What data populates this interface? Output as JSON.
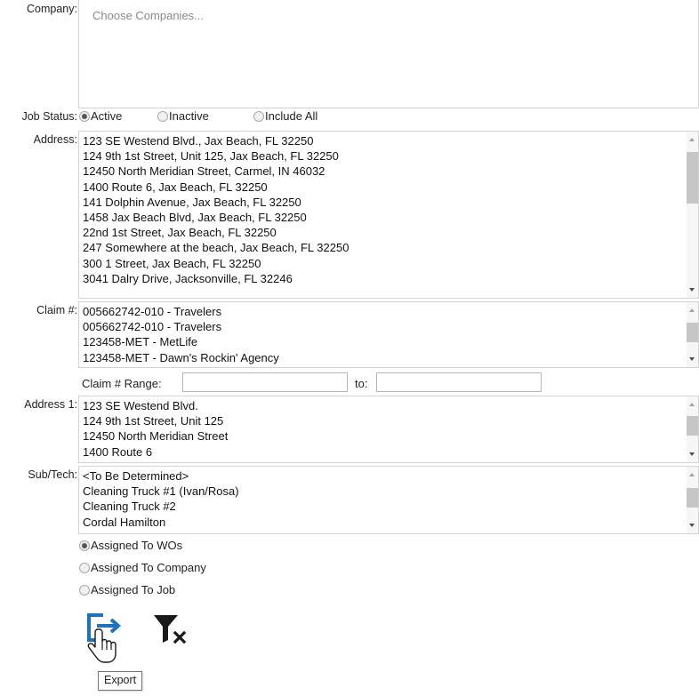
{
  "company": {
    "label": "Company:",
    "placeholder": "Choose Companies..."
  },
  "job_status": {
    "label": "Job Status:",
    "options": [
      {
        "label": "Active",
        "selected": true
      },
      {
        "label": "Inactive",
        "selected": false
      },
      {
        "label": "Include All",
        "selected": false
      }
    ]
  },
  "address": {
    "label": "Address:",
    "items": [
      "123 SE Westend Blvd., Jax Beach, FL 32250",
      "124 9th 1st Street, Unit 125, Jax Beach, FL 32250",
      "12450 North Meridian Street, Carmel, IN 46032",
      "1400 Route 6, Jax Beach, FL 32250",
      "141 Dolphin Avenue, Jax Beach, FL 32250",
      "1458 Jax Beach Blvd, Jax Beach, FL 32250",
      "22nd 1st Street, Jax Beach, FL 32250",
      "247 Somewhere at the beach, Jax Beach, FL 32250",
      "300 1 Street, Jax Beach, FL 32250",
      "3041 Dalry Drive, Jacksonville, FL 32246"
    ]
  },
  "claim": {
    "label": "Claim #:",
    "items": [
      "005662742-010 - Travelers",
      "005662742-010 - Travelers",
      "123458-MET - MetLife",
      "123458-MET - Dawn's Rockin' Agency"
    ]
  },
  "claim_range": {
    "label": "Claim # Range:",
    "from_value": "",
    "to_label": "to:",
    "to_value": ""
  },
  "address1": {
    "label": "Address 1:",
    "items": [
      "123 SE Westend Blvd.",
      "124 9th 1st Street, Unit 125",
      "12450 North Meridian Street",
      "1400 Route 6"
    ]
  },
  "subtech": {
    "label": "Sub/Tech:",
    "items": [
      "<To Be Determined>",
      "Cleaning Truck #1 (Ivan/Rosa)",
      "Cleaning Truck #2",
      "Cordal Hamilton"
    ]
  },
  "assignment": {
    "options": [
      {
        "label": "Assigned To WOs",
        "selected": true
      },
      {
        "label": "Assigned To Company",
        "selected": false
      },
      {
        "label": "Assigned To Job",
        "selected": false
      }
    ]
  },
  "actions": {
    "export_icon": "export-icon",
    "clear_filter_icon": "clear-filter-icon",
    "export_tooltip": "Export"
  },
  "colors": {
    "accent": "#1e73be",
    "text": "#1f1f1f",
    "border": "#d4d4d4"
  }
}
